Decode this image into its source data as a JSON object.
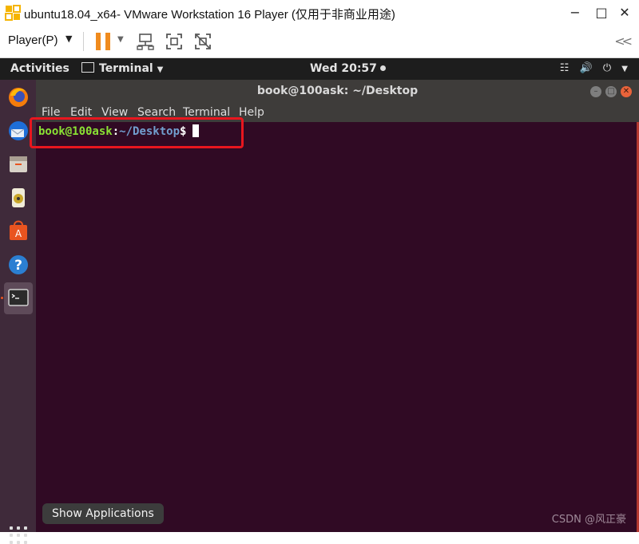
{
  "window": {
    "title": "ubuntu18.04_x64- VMware Workstation 16 Player (仅用于非商业用途)",
    "minimize": "−",
    "maximize": "□",
    "close": "✕",
    "icon": "vmware-icon"
  },
  "toolbar": {
    "player_menu": "Player(P)",
    "pause_icon": "pause-icon",
    "collapse": "<<",
    "accent": "#f08b1e"
  },
  "ubuntu_topbar": {
    "activities": "Activities",
    "app_name": "Terminal",
    "clock": "Wed 20:57",
    "tray_icons": [
      "network-icon",
      "volume-icon",
      "power-icon"
    ]
  },
  "dock": {
    "items": [
      "firefox-icon",
      "thunderbird-icon",
      "files-icon",
      "rhythmbox-icon",
      "software-icon",
      "help-icon",
      "terminal-icon"
    ],
    "show_apps_tooltip": "Show Applications"
  },
  "terminal": {
    "title": "book@100ask: ~/Desktop",
    "menu": [
      "File",
      "Edit",
      "View",
      "Search",
      "Terminal",
      "Help"
    ],
    "prompt_user": "book@100ask",
    "prompt_colon": ":",
    "prompt_path": "~/Desktop",
    "prompt_symbol": "$"
  },
  "watermark": "CSDN @风正豪"
}
